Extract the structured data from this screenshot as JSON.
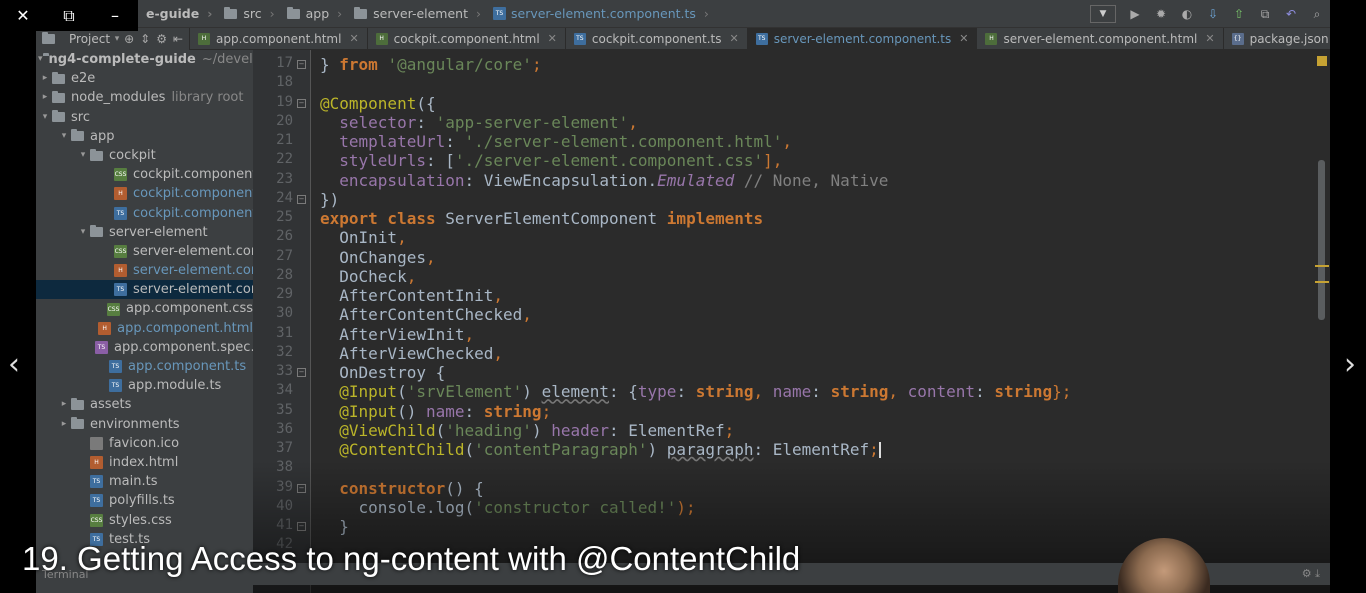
{
  "breadcrumbs": [
    {
      "label": "e-guide",
      "bold": true
    },
    {
      "label": "src"
    },
    {
      "label": "app"
    },
    {
      "label": "server-element"
    },
    {
      "label": "server-element.component.ts",
      "file": true
    }
  ],
  "project_panel": {
    "label": "Project"
  },
  "tabs": [
    {
      "label": "app.component.html",
      "type": "html"
    },
    {
      "label": "cockpit.component.html",
      "type": "html"
    },
    {
      "label": "cockpit.component.ts",
      "type": "ts"
    },
    {
      "label": "server-element.component.ts",
      "type": "ts",
      "active": true
    },
    {
      "label": "server-element.component.html",
      "type": "html"
    },
    {
      "label": "package.json",
      "type": "json"
    }
  ],
  "tab_overflow": "⋮1",
  "tree": [
    {
      "label": "ng4-complete-guide",
      "extra": "~/develop",
      "arrow": "▾",
      "icon": "folder",
      "bold": true,
      "indent": 0
    },
    {
      "label": "e2e",
      "arrow": "▸",
      "icon": "folder",
      "indent": 0
    },
    {
      "label": "node_modules",
      "extra": "library root",
      "arrow": "▸",
      "icon": "folder",
      "indent": 0
    },
    {
      "label": "src",
      "arrow": "▾",
      "icon": "folder",
      "indent": 0
    },
    {
      "label": "app",
      "arrow": "▾",
      "icon": "folder",
      "indent": 1
    },
    {
      "label": "cockpit",
      "arrow": "▾",
      "icon": "folder",
      "indent": 2
    },
    {
      "label": "cockpit.component.",
      "icon": "css",
      "indent": 4
    },
    {
      "label": "cockpit.component.",
      "icon": "html",
      "blue": true,
      "indent": 4
    },
    {
      "label": "cockpit.component.",
      "icon": "ts",
      "blue": true,
      "indent": 4
    },
    {
      "label": "server-element",
      "arrow": "▾",
      "icon": "folder",
      "indent": 2
    },
    {
      "label": "server-element.com",
      "icon": "css",
      "indent": 4
    },
    {
      "label": "server-element.com",
      "icon": "html",
      "blue": true,
      "indent": 4
    },
    {
      "label": "server-element.com",
      "icon": "ts",
      "selected": true,
      "indent": 4
    },
    {
      "label": "app.component.css",
      "icon": "css",
      "indent": 3
    },
    {
      "label": "app.component.html",
      "icon": "html",
      "blue": true,
      "indent": 3
    },
    {
      "label": "app.component.spec.ts",
      "icon": "spec",
      "indent": 3
    },
    {
      "label": "app.component.ts",
      "icon": "ts",
      "blue": true,
      "indent": 3
    },
    {
      "label": "app.module.ts",
      "icon": "ts",
      "indent": 3
    },
    {
      "label": "assets",
      "arrow": "▸",
      "icon": "folder",
      "indent": 1
    },
    {
      "label": "environments",
      "arrow": "▸",
      "icon": "folder",
      "indent": 1
    },
    {
      "label": "favicon.ico",
      "icon": "ico",
      "indent": 2
    },
    {
      "label": "index.html",
      "icon": "html",
      "indent": 2
    },
    {
      "label": "main.ts",
      "icon": "ts",
      "indent": 2
    },
    {
      "label": "polyfills.ts",
      "icon": "ts",
      "indent": 2
    },
    {
      "label": "styles.css",
      "icon": "css",
      "indent": 2
    },
    {
      "label": "test.ts",
      "icon": "ts",
      "indent": 2
    }
  ],
  "code": [
    {
      "n": 17,
      "fold": "close",
      "tokens": [
        [
          "} ",
          ""
        ],
        [
          "from ",
          "kw"
        ],
        [
          "'@angular/core'",
          "str"
        ],
        [
          ";",
          "punc"
        ]
      ]
    },
    {
      "n": 18,
      "tokens": []
    },
    {
      "n": 19,
      "fold": "open",
      "tokens": [
        [
          "@Component",
          "ann"
        ],
        [
          "({",
          ""
        ]
      ]
    },
    {
      "n": 20,
      "tokens": [
        [
          "  selector",
          "prop"
        ],
        [
          ": ",
          ""
        ],
        [
          "'app-server-element'",
          "str"
        ],
        [
          ",",
          "punc"
        ]
      ]
    },
    {
      "n": 21,
      "tokens": [
        [
          "  templateUrl",
          "prop"
        ],
        [
          ": ",
          ""
        ],
        [
          "'./server-element.component.html'",
          "str"
        ],
        [
          ",",
          "punc"
        ]
      ]
    },
    {
      "n": 22,
      "tokens": [
        [
          "  styleUrls",
          "prop"
        ],
        [
          ": [",
          ""
        ],
        [
          "'./server-element.component.css'",
          "str"
        ],
        [
          "],",
          "punc"
        ]
      ]
    },
    {
      "n": 23,
      "tokens": [
        [
          "  encapsulation",
          "prop"
        ],
        [
          ": ViewEncapsulation.",
          ""
        ],
        [
          "Emulated",
          "ital"
        ],
        [
          " // None, Native",
          "cmt"
        ]
      ]
    },
    {
      "n": 24,
      "fold": "close",
      "tokens": [
        [
          "})",
          ""
        ]
      ]
    },
    {
      "n": 25,
      "tokens": [
        [
          "export class ",
          "kw"
        ],
        [
          "ServerElementComponent ",
          ""
        ],
        [
          "implements",
          "kw"
        ]
      ]
    },
    {
      "n": 26,
      "tokens": [
        [
          "  OnInit",
          ""
        ],
        [
          ",",
          "punc"
        ]
      ]
    },
    {
      "n": 27,
      "tokens": [
        [
          "  OnChanges",
          ""
        ],
        [
          ",",
          "punc"
        ]
      ]
    },
    {
      "n": 28,
      "tokens": [
        [
          "  DoCheck",
          ""
        ],
        [
          ",",
          "punc"
        ]
      ]
    },
    {
      "n": 29,
      "tokens": [
        [
          "  AfterContentInit",
          ""
        ],
        [
          ",",
          "punc"
        ]
      ]
    },
    {
      "n": 30,
      "tokens": [
        [
          "  AfterContentChecked",
          ""
        ],
        [
          ",",
          "punc"
        ]
      ]
    },
    {
      "n": 31,
      "tokens": [
        [
          "  AfterViewInit",
          ""
        ],
        [
          ",",
          "punc"
        ]
      ]
    },
    {
      "n": 32,
      "tokens": [
        [
          "  AfterViewChecked",
          ""
        ],
        [
          ",",
          "punc"
        ]
      ]
    },
    {
      "n": 33,
      "fold": "open",
      "tokens": [
        [
          "  OnDestroy {",
          ""
        ]
      ]
    },
    {
      "n": 34,
      "tokens": [
        [
          "  @Input",
          "ann"
        ],
        [
          "(",
          ""
        ],
        [
          "'srvElement'",
          "str"
        ],
        [
          ") ",
          ""
        ],
        [
          "element",
          "underl"
        ],
        [
          ": {",
          ""
        ],
        [
          "type",
          "prop"
        ],
        [
          ": ",
          ""
        ],
        [
          "string",
          "kw"
        ],
        [
          ", ",
          "punc"
        ],
        [
          "name",
          "prop"
        ],
        [
          ": ",
          ""
        ],
        [
          "string",
          "kw"
        ],
        [
          ", ",
          "punc"
        ],
        [
          "content",
          "prop"
        ],
        [
          ": ",
          ""
        ],
        [
          "string",
          "kw"
        ],
        [
          "};",
          "punc"
        ]
      ]
    },
    {
      "n": 35,
      "tokens": [
        [
          "  @Input",
          "ann"
        ],
        [
          "() ",
          ""
        ],
        [
          "name",
          "prop"
        ],
        [
          ": ",
          ""
        ],
        [
          "string",
          "kw"
        ],
        [
          ";",
          "punc"
        ]
      ]
    },
    {
      "n": 36,
      "tokens": [
        [
          "  @ViewChild",
          "ann"
        ],
        [
          "(",
          ""
        ],
        [
          "'heading'",
          "str"
        ],
        [
          ") ",
          ""
        ],
        [
          "header",
          "prop"
        ],
        [
          ": ElementRef",
          ""
        ],
        [
          ";",
          "punc"
        ]
      ]
    },
    {
      "n": 37,
      "caret": true,
      "tokens": [
        [
          "  @ContentChild",
          "ann"
        ],
        [
          "(",
          ""
        ],
        [
          "'contentParagraph'",
          "str"
        ],
        [
          ") ",
          ""
        ],
        [
          "paragraph",
          "underl"
        ],
        [
          ": ElementRef",
          ""
        ],
        [
          ";",
          "punc"
        ]
      ]
    },
    {
      "n": 38,
      "tokens": []
    },
    {
      "n": 39,
      "fold": "open",
      "tokens": [
        [
          "  constructor",
          "kw"
        ],
        [
          "() {",
          ""
        ]
      ]
    },
    {
      "n": 40,
      "tokens": [
        [
          "    console.log(",
          ""
        ],
        [
          "'constructor called!'",
          "str"
        ],
        [
          ");",
          "punc"
        ]
      ]
    },
    {
      "n": 41,
      "fold": "close",
      "tokens": [
        [
          "  }",
          ""
        ]
      ]
    },
    {
      "n": 42,
      "tokens": []
    }
  ],
  "terminal_label": "Terminal",
  "window_controls": {
    "close": "✕",
    "restore": "⧉",
    "minimize": "–"
  },
  "slide_nav": {
    "prev": "‹",
    "next": "›"
  },
  "caption": "19. Getting Access to ng-content with @ContentChild",
  "colors": {
    "keyword": "#cc7832",
    "string": "#6a8759",
    "annotation": "#bbb529",
    "background": "#2b2b2b"
  }
}
